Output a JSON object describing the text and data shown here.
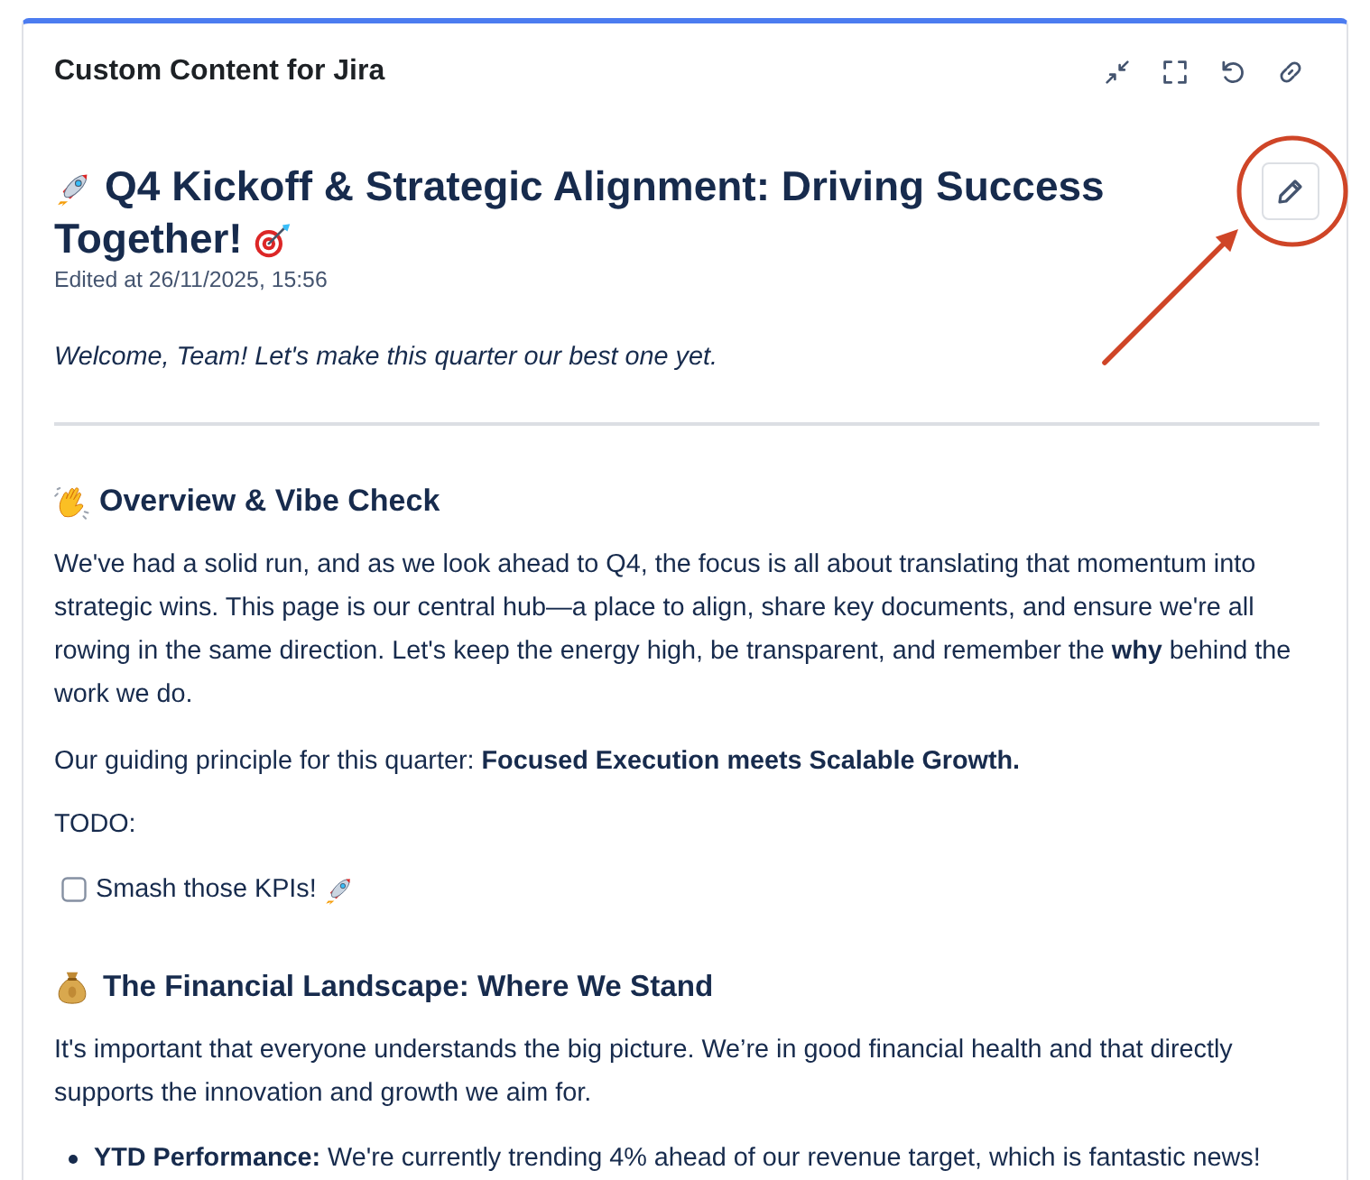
{
  "panel": {
    "title": "Custom Content for Jira"
  },
  "page": {
    "title_lines": [
      "Q4 Kickoff & Strategic Alignment: Driving Success",
      "Together!"
    ],
    "edited": "Edited at 26/11/2025, 15:56",
    "welcome": "Welcome, Team! Let's make this quarter our best one yet."
  },
  "overview": {
    "heading": "Overview & Vibe Check",
    "paragraphs": [
      "We've had a solid run, and as we look ahead to Q4, the focus is all about translating that momentum into strategic wins. This page is our central hub—a place to align, share key documents, and ensure we're all rowing in the same direction. Let's keep the energy high, be transparent, and remember the **why** behind the work we do.",
      "Our guiding principle for this quarter: **Focused Execution meets Scalable Growth.**"
    ],
    "todo_label": "TODO:",
    "tasks": [
      {
        "label": "Smash those KPIs!",
        "checked": false
      }
    ]
  },
  "financial": {
    "heading": "The Financial Landscape: Where We Stand",
    "paragraph": "It's important that everyone understands the big picture. We’re in good financial health and that directly supports the innovation and growth we aim for.",
    "bullets": [
      "**YTD Performance:** We're currently trending 4% ahead of our revenue target, which is fantastic news!"
    ]
  }
}
